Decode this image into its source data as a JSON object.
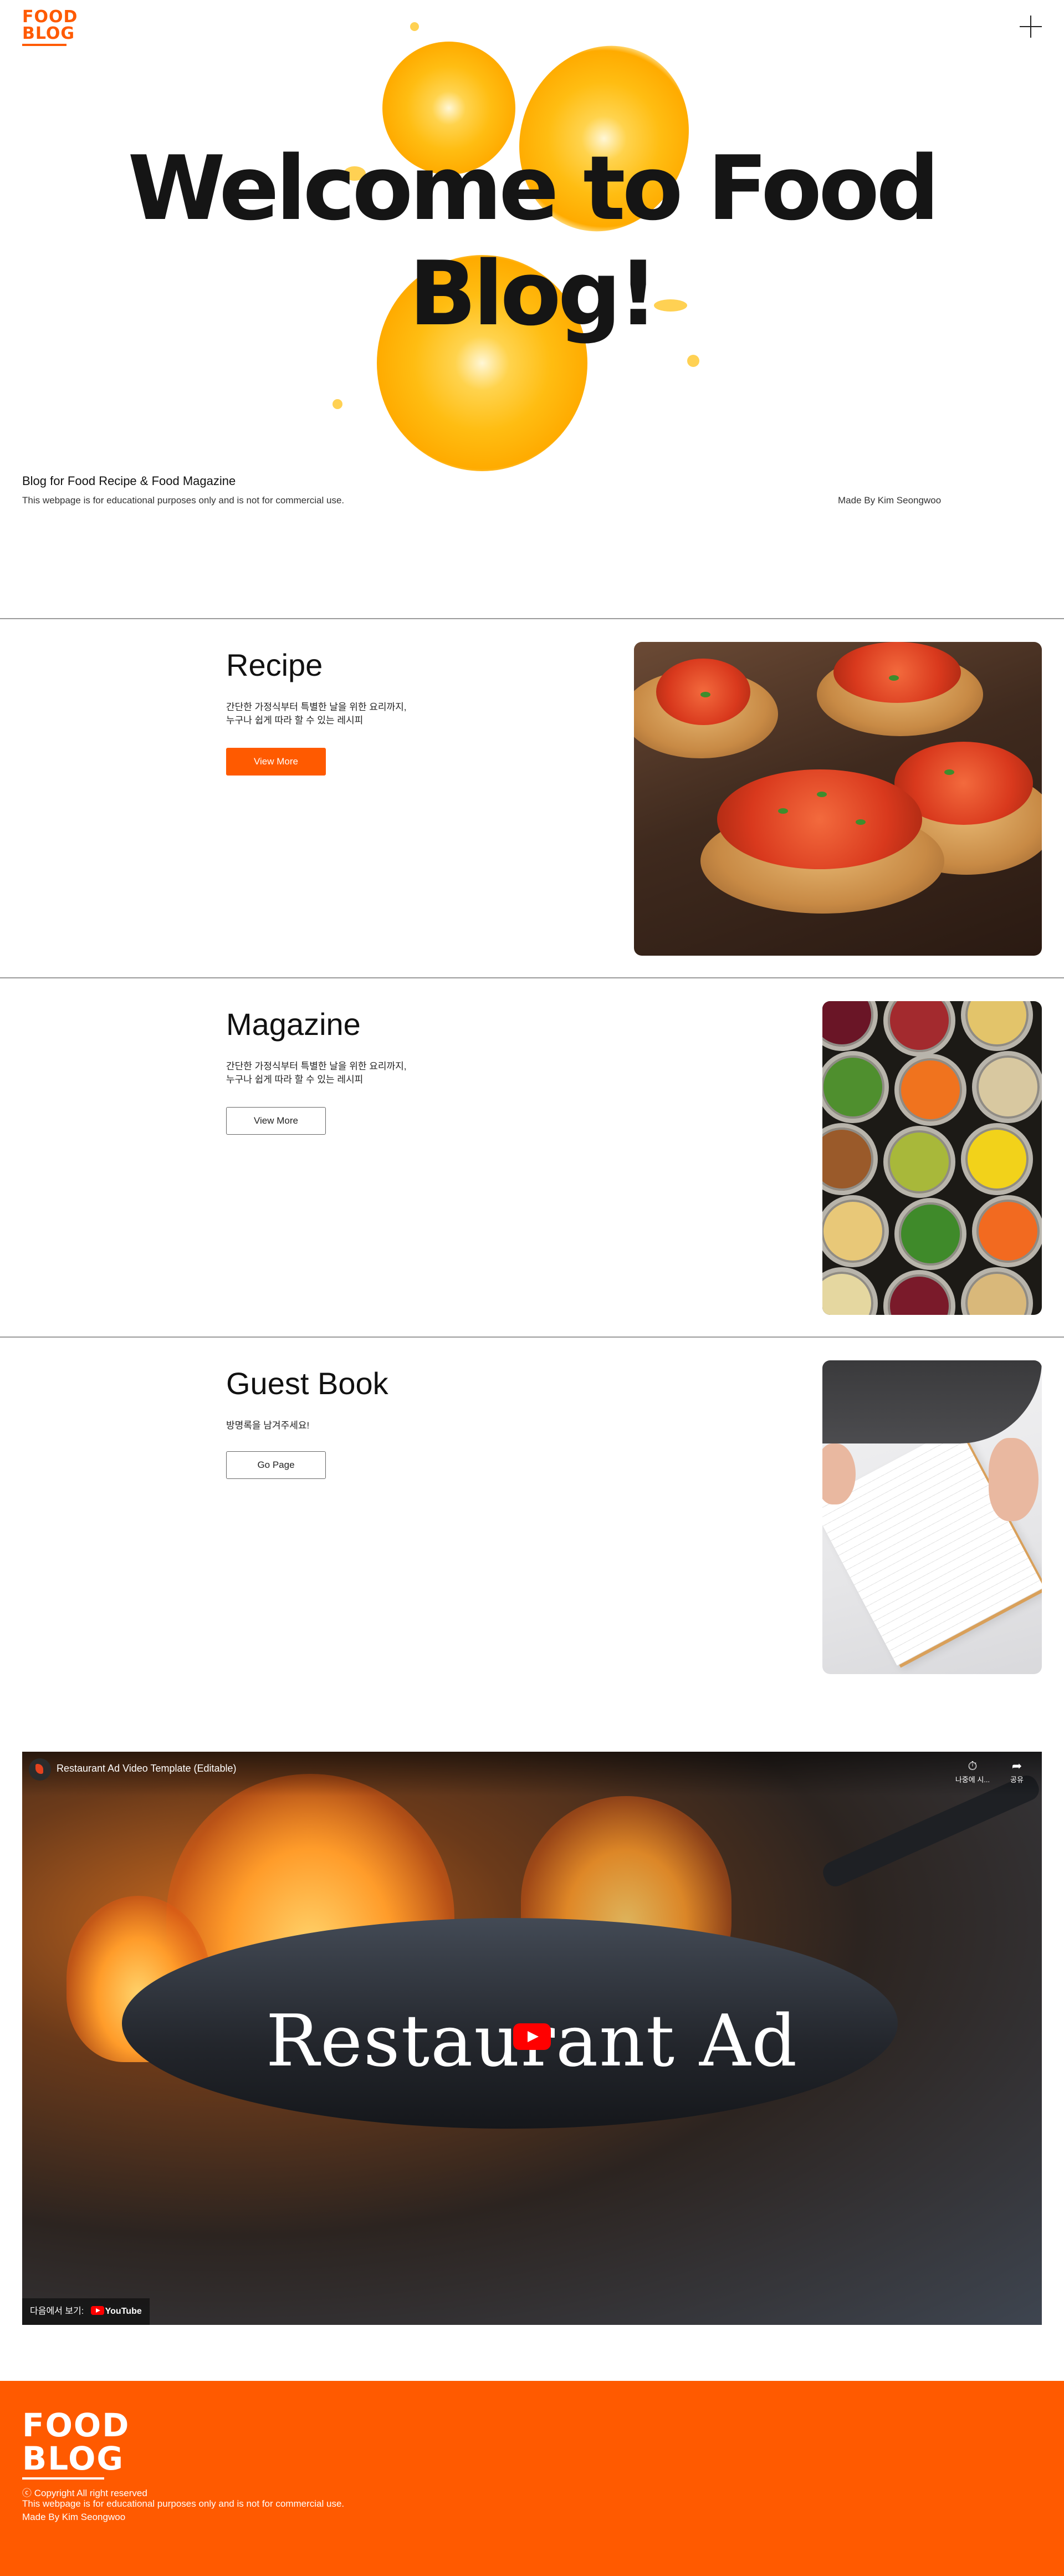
{
  "header": {
    "logo_line1": "FOOD",
    "logo_line2": "BLOG",
    "menu_icon": "plus-icon"
  },
  "hero": {
    "title": "Welcome to Food Blog!",
    "subtitle": "Blog for Food Recipe & Food Magazine",
    "note": "This webpage is for educational purposes only and is not for commercial use.",
    "made_by": "Made By Kim Seongwoo"
  },
  "sections": [
    {
      "title": "Recipe",
      "description": "간단한 가정식부터 특별한 날을 위한 요리까지,\n누구나 쉽게 따라 할 수 있는 레시피",
      "button_label": "View More"
    },
    {
      "title": "Magazine",
      "description": "간단한 가정식부터 특별한 날을 위한 요리까지,\n누구나 쉽게 따라 할 수 있는 레시피",
      "button_label": "View More"
    },
    {
      "title": "Guest Book",
      "description": "방명록을 남겨주세요!",
      "button_label": "Go Page"
    }
  ],
  "video": {
    "title": "Restaurant Ad Video Template (Editable)",
    "overlay_text": "Restaurant Ad",
    "action_watch_later": "나중에 시...",
    "action_share": "공유",
    "watch_on": "다음에서 보기:",
    "platform": "YouTube"
  },
  "footer": {
    "logo_line1": "FOOD",
    "logo_line2": "BLOG",
    "copyright": "ⓒ Copyright All right reserved",
    "note": "This webpage is for educational purposes only and is not for commercial use.",
    "made_by": "Made By Kim Seongwoo"
  },
  "colors": {
    "accent": "#ff5a00",
    "text": "#111111",
    "divider": "#9a9a9a"
  }
}
